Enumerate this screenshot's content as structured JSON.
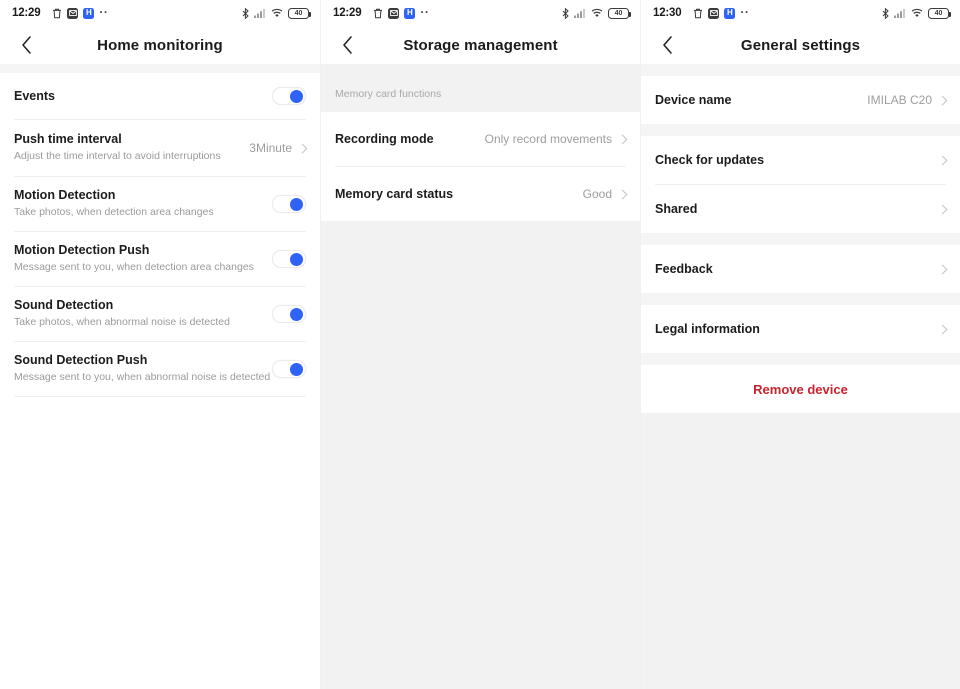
{
  "screens": [
    {
      "status": {
        "time": "12:29",
        "icons": [
          "trash-icon",
          "mail-icon",
          "h-badge-icon",
          "overflow-dots-icon"
        ],
        "h_badge_label": "H",
        "right_icons": [
          "bluetooth-icon",
          "signal-icon",
          "wifi-icon",
          "battery-icon"
        ],
        "battery_level": "40"
      },
      "title": "Home monitoring",
      "back_icon": "back-chevron-icon",
      "rows": [
        {
          "title": "Events",
          "sub": "",
          "control": "toggle",
          "value": "",
          "on": true
        },
        {
          "title": "Push time interval",
          "sub": "Adjust the time interval to avoid interruptions",
          "control": "value",
          "value": "3Minute",
          "on": false
        },
        {
          "title": "Motion Detection",
          "sub": "Take photos, when detection area changes",
          "control": "toggle",
          "value": "",
          "on": true
        },
        {
          "title": "Motion Detection Push",
          "sub": "Message sent to you, when detection area changes",
          "control": "toggle",
          "value": "",
          "on": true
        },
        {
          "title": "Sound Detection",
          "sub": "Take photos, when abnormal noise is detected",
          "control": "toggle",
          "value": "",
          "on": true
        },
        {
          "title": "Sound Detection Push",
          "sub": "Message sent to you, when abnormal noise is detected",
          "control": "toggle",
          "value": "",
          "on": true
        }
      ]
    },
    {
      "status": {
        "time": "12:29",
        "h_badge_label": "H",
        "battery_level": "40"
      },
      "title": "Storage management",
      "back_icon": "back-chevron-icon",
      "section_header": "Memory card functions",
      "rows": [
        {
          "title": "Recording mode",
          "sub": "",
          "control": "value",
          "value": "Only record movements",
          "on": false
        },
        {
          "title": "Memory card status",
          "sub": "",
          "control": "value",
          "value": "Good",
          "on": false
        }
      ]
    },
    {
      "status": {
        "time": "12:30",
        "h_badge_label": "H",
        "battery_level": "40"
      },
      "title": "General settings",
      "back_icon": "back-chevron-icon",
      "groups": [
        {
          "rows": [
            {
              "title": "Device name",
              "value": "IMILAB C20"
            }
          ]
        },
        {
          "rows": [
            {
              "title": "Check for updates",
              "value": ""
            },
            {
              "title": "Shared",
              "value": ""
            }
          ]
        },
        {
          "rows": [
            {
              "title": "Feedback",
              "value": ""
            }
          ]
        },
        {
          "rows": [
            {
              "title": "Legal information",
              "value": ""
            }
          ]
        }
      ],
      "remove_device_label": "Remove device"
    }
  ],
  "colors": {
    "accent": "#2f63f5",
    "danger": "#c8242d",
    "page_bg": "#f2f2f2",
    "card_bg": "#ffffff",
    "divider": "#efefef",
    "muted_text": "#9b9b9b"
  }
}
